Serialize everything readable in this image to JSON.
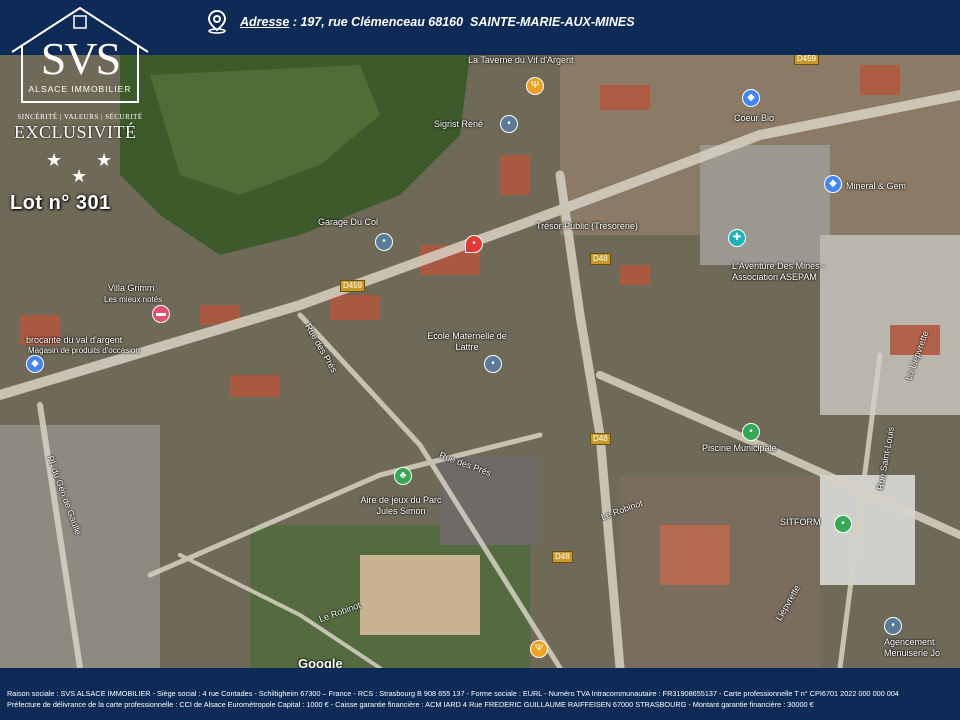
{
  "header": {
    "address_label": "Adresse",
    "address_value": " : 197, rue Clémenceau 68160  SAINTE-MARIE-AUX-MINES"
  },
  "logo": {
    "name": "SVS",
    "subtitle": "ALSACE IMMOBILIER",
    "values": "SINCÉRITÉ | VALEURS | SÉCURITÉ",
    "exclusivity": "EXCLUSIVITÉ",
    "lot": "Lot n° 301"
  },
  "map": {
    "labels": [
      "La Taverne du Vif d'Argent",
      "Sigrist René",
      "Coeur Bio",
      "Mineral & Gem",
      "Garage Du Col",
      "Trésor Public (Trésorerie)",
      "L'Aventure Des Mines - Association ASEPAM",
      "Villa Grimm",
      "Les mieux notés",
      "brocante du val d'argent",
      "Magasin de produits d'occasion",
      "Ecole Maternelle de Lattre",
      "Rue des Prés",
      "Rue des Prés",
      "Pl. du Gén de Gaulle",
      "Aire de jeux du Parc Jules Simon",
      "Piscine Municipale",
      "Le Robinot",
      "SITFORM",
      "Rue Saint-Louis",
      "La Liepvrette",
      "Le Robinot",
      "Liepvrette",
      "Agencement Menuiserie Jo",
      "Google"
    ],
    "roads": [
      "D459",
      "D459",
      "D48",
      "D48",
      "D48"
    ]
  },
  "footer": {
    "line1": "Raison sociale : SVS ALSACE IMMOBILIER - Siège social : 4 rue Contades - Schiltigheim 67300 – France - RCS : Strasbourg B 908 655 137 - Forme sociale : EURL - Numéro TVA Intracommunautaire : FR31908655137 - Carte professionnelle T n° CPI6701 2022 000 000 004",
    "line2": "Préfecture de délivrance de la carte professionnelle : CCI de Alsace Eurométropole   Capital : 1000 € -  Caisse garantie financière : ACM IARD 4 Rue FREDERIC GUILLAUME RAIFFEISEN 67000 STRASBOURG - Montant garantie financière : 30000 €"
  }
}
